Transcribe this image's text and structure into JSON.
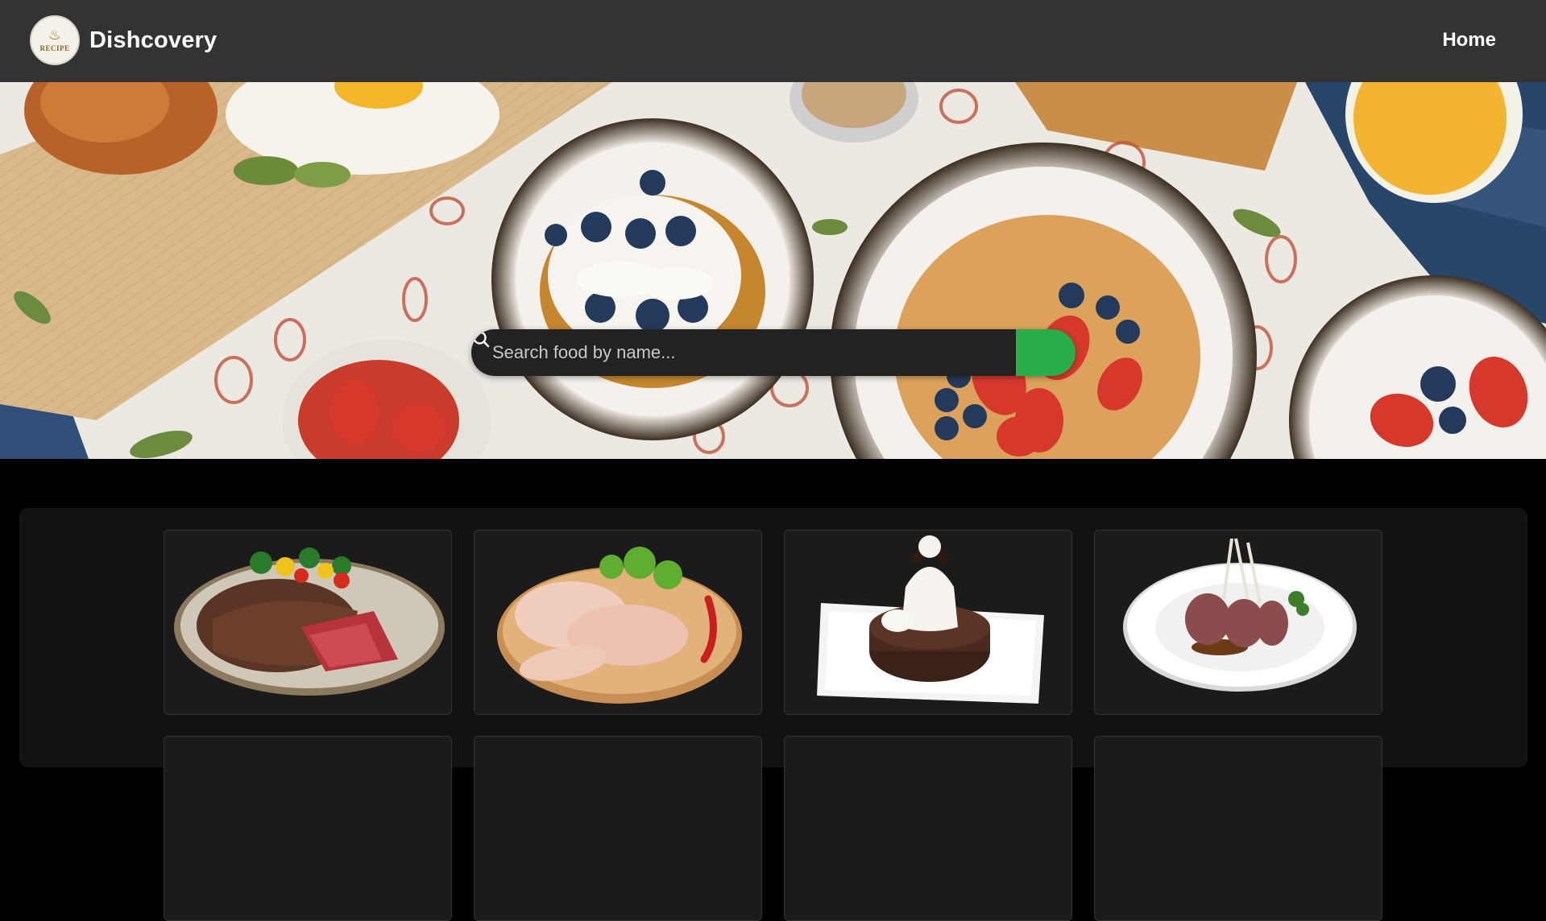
{
  "header": {
    "logo_text": "RECIPE",
    "brand": "Dishcovery",
    "nav": [
      {
        "label": "Home"
      }
    ]
  },
  "hero": {
    "search": {
      "placeholder": "Search food by name...",
      "value": "",
      "button_icon": "search-icon"
    }
  },
  "cards": [
    {
      "dish": "steak",
      "icon": "steak-image"
    },
    {
      "dish": "chicken",
      "icon": "chicken-image"
    },
    {
      "dish": "dessert",
      "icon": "dessert-image"
    },
    {
      "dish": "lamb",
      "icon": "lamb-image"
    },
    {
      "dish": "",
      "icon": "card-image"
    },
    {
      "dish": "",
      "icon": "card-image"
    },
    {
      "dish": "",
      "icon": "card-image"
    },
    {
      "dish": "",
      "icon": "card-image"
    }
  ],
  "colors": {
    "header_bg": "#333333",
    "page_bg": "#000000",
    "panel_bg": "#121212",
    "card_bg": "#1b1b1b",
    "accent": "#27ae48"
  }
}
